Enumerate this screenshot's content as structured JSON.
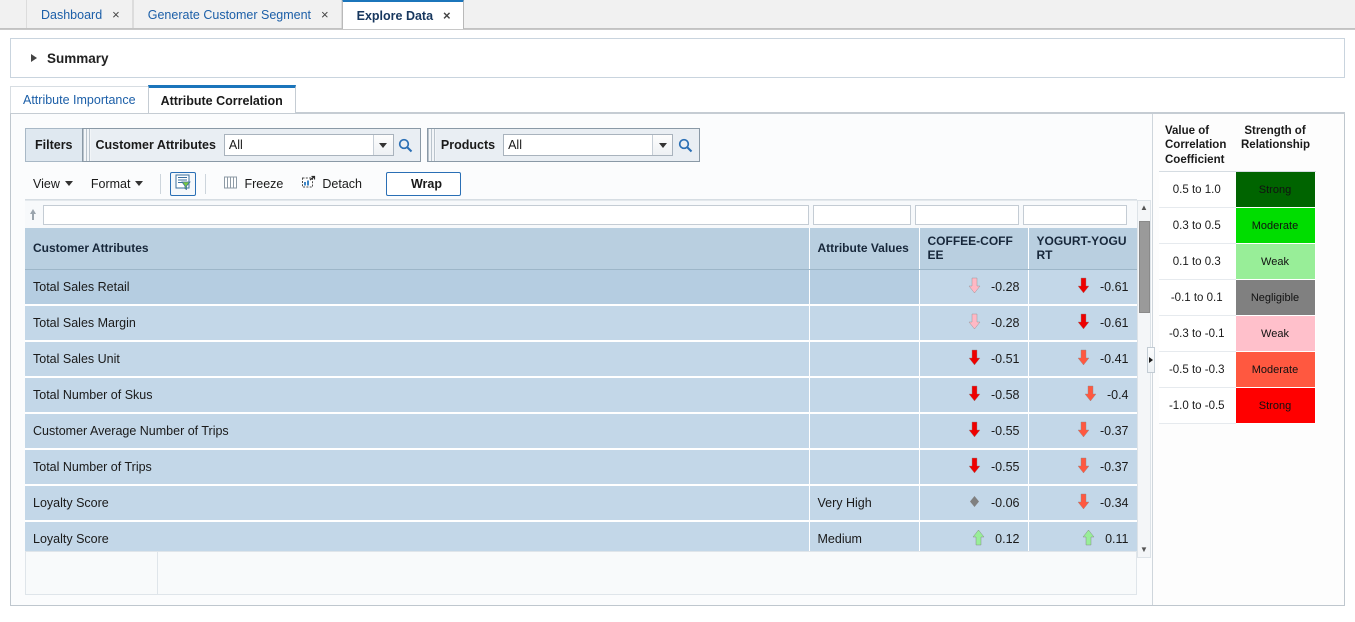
{
  "browser_tabs": [
    {
      "label": "Dashboard",
      "active": false,
      "close": "×"
    },
    {
      "label": "Generate Customer Segment",
      "active": false,
      "close": "×"
    },
    {
      "label": "Explore Data",
      "active": true,
      "close": "×"
    }
  ],
  "summary": {
    "title": "Summary",
    "expanded": false
  },
  "subtabs": [
    {
      "label": "Attribute Importance",
      "active": false
    },
    {
      "label": "Attribute Correlation",
      "active": true
    }
  ],
  "filters": {
    "label": "Filters",
    "groups": [
      {
        "name": "Customer Attributes",
        "value": "All",
        "placeholder": "All",
        "search_icon": "search-icon",
        "dropdown_icon": "chevron-down-icon"
      },
      {
        "name": "Products",
        "value": "All",
        "placeholder": "All",
        "search_icon": "search-icon",
        "dropdown_icon": "chevron-down-icon"
      }
    ]
  },
  "toolbar": {
    "view_label": "View",
    "format_label": "Format",
    "query_icon": "query-by-example-icon",
    "freeze_label": "Freeze",
    "freeze_icon": "freeze-icon",
    "detach_label": "Detach",
    "detach_icon": "detach-icon",
    "wrap_label": "Wrap",
    "wrap_icon": "wrap-icon"
  },
  "table": {
    "qbe": {
      "filter_icon": "sort-filter-icon",
      "values": [
        "",
        "",
        "",
        ""
      ]
    },
    "columns": [
      "Customer Attributes",
      "Attribute Values",
      "COFFEE-COFFEE",
      "YOGURT-YOGURT"
    ],
    "rows": [
      {
        "attribute": "Total Sales Retail",
        "value": "",
        "coffee": "-0.28",
        "coffee_dir": "down",
        "coffee_color": "#FFB8C4",
        "yogurt": "-0.61",
        "yogurt_dir": "down",
        "yogurt_color": "#EE0000",
        "selected": true
      },
      {
        "attribute": "Total Sales Margin",
        "value": "",
        "coffee": "-0.28",
        "coffee_dir": "down",
        "coffee_color": "#FFB8C4",
        "yogurt": "-0.61",
        "yogurt_dir": "down",
        "yogurt_color": "#EE0000",
        "selected": false
      },
      {
        "attribute": "Total Sales Unit",
        "value": "",
        "coffee": "-0.51",
        "coffee_dir": "down",
        "coffee_color": "#EE0000",
        "yogurt": "-0.41",
        "yogurt_dir": "down",
        "yogurt_color": "#FF5840",
        "selected": false
      },
      {
        "attribute": "Total Number of Skus",
        "value": "",
        "coffee": "-0.58",
        "coffee_dir": "down",
        "coffee_color": "#EE0000",
        "yogurt": "-0.4",
        "yogurt_dir": "down",
        "yogurt_color": "#FF5840",
        "selected": false
      },
      {
        "attribute": "Customer Average Number of Trips",
        "value": "",
        "coffee": "-0.55",
        "coffee_dir": "down",
        "coffee_color": "#EE0000",
        "yogurt": "-0.37",
        "yogurt_dir": "down",
        "yogurt_color": "#FF5840",
        "selected": false
      },
      {
        "attribute": "Total Number of Trips",
        "value": "",
        "coffee": "-0.55",
        "coffee_dir": "down",
        "coffee_color": "#EE0000",
        "yogurt": "-0.37",
        "yogurt_dir": "down",
        "yogurt_color": "#FF5840",
        "selected": false
      },
      {
        "attribute": "Loyalty Score",
        "value": "Very High",
        "coffee": "-0.06",
        "coffee_dir": "neutral",
        "coffee_color": "#808080",
        "yogurt": "-0.34",
        "yogurt_dir": "down",
        "yogurt_color": "#FF5840",
        "selected": false
      },
      {
        "attribute": "Loyalty Score",
        "value": "Medium",
        "coffee": "0.12",
        "coffee_dir": "up",
        "coffee_color": "#98EE98",
        "yogurt": "0.11",
        "yogurt_dir": "up",
        "yogurt_color": "#98EE98",
        "selected": false
      }
    ],
    "scroll_up_icon": "scroll-up-arrow-icon",
    "scroll_down_icon": "scroll-down-arrow-icon"
  },
  "legend": {
    "header_value": "Value of Correlation Coefficient",
    "header_strength": "Strength of Relationship",
    "rows": [
      {
        "range": "0.5 to 1.0",
        "strength": "Strong",
        "color": "#006400"
      },
      {
        "range": "0.3 to 0.5",
        "strength": "Moderate",
        "color": "#00DD00"
      },
      {
        "range": "0.1 to 0.3",
        "strength": "Weak",
        "color": "#98EE98"
      },
      {
        "range": "-0.1 to 0.1",
        "strength": "Negligible",
        "color": "#808080"
      },
      {
        "range": "-0.3 to -0.1",
        "strength": "Weak",
        "color": "#FFC0CB"
      },
      {
        "range": "-0.5 to -0.3",
        "strength": "Moderate",
        "color": "#FF5840"
      },
      {
        "range": "-1.0 to -0.5",
        "strength": "Strong",
        "color": "#FF0000"
      }
    ]
  },
  "splitter": {
    "icon": "splitter-collapse-icon"
  },
  "edge_collapse": {
    "icon": "panel-expand-arrow-icon"
  }
}
